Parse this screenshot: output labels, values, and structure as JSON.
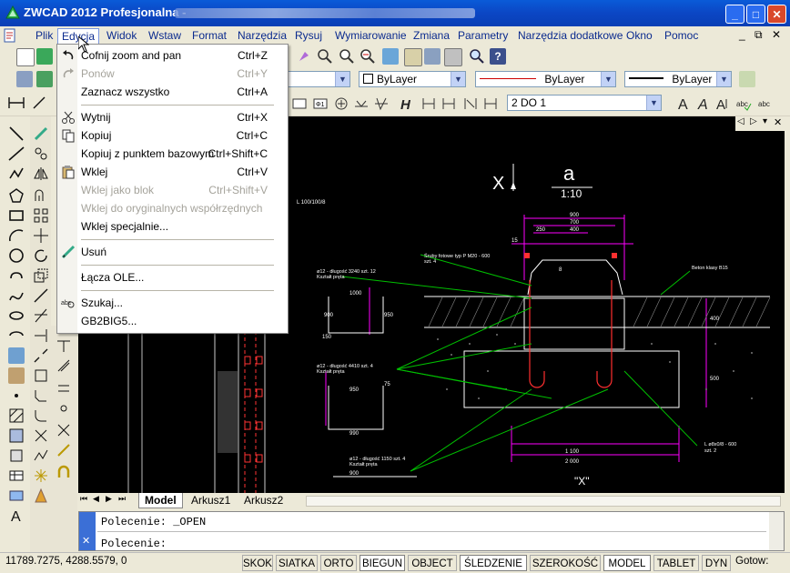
{
  "window": {
    "title": "ZWCAD 2012 Profesjonalna -",
    "minimize_glyph": "_",
    "maximize_glyph": "□",
    "close_glyph": "✕"
  },
  "menubar": {
    "items": [
      "Plik",
      "Edycja",
      "Widok",
      "Wstaw",
      "Format",
      "Narzędzia",
      "Rysuj",
      "Wymiarowanie",
      "Zmiana",
      "Parametry",
      "Narzędzia dodatkowe",
      "Okno",
      "Pomoc"
    ],
    "active": "Edycja",
    "doc_controls": [
      "_",
      "⧉",
      "✕"
    ]
  },
  "properties": {
    "color": "ByLayer",
    "linetype": "ByLayer",
    "lineweight": "ByLayer",
    "dimstyle": "2 DO 1"
  },
  "edit_menu": {
    "items": [
      {
        "label": "Cofnij  zoom and pan",
        "shortcut": "Ctrl+Z",
        "disabled": false,
        "icon": "undo-icon"
      },
      {
        "label": "Ponów",
        "shortcut": "Ctrl+Y",
        "disabled": true,
        "icon": "redo-icon"
      },
      {
        "label": "Zaznacz wszystko",
        "shortcut": "Ctrl+A",
        "disabled": false,
        "icon": ""
      },
      {
        "label": "Wytnij",
        "shortcut": "Ctrl+X",
        "disabled": false,
        "icon": "scissors-icon"
      },
      {
        "label": "Kopiuj",
        "shortcut": "Ctrl+C",
        "disabled": false,
        "icon": "copy-icon"
      },
      {
        "label": "Kopiuj z punktem bazowym",
        "shortcut": "Ctrl+Shift+C",
        "disabled": false,
        "icon": ""
      },
      {
        "label": "Wklej",
        "shortcut": "Ctrl+V",
        "disabled": false,
        "icon": "paste-icon"
      },
      {
        "label": "Wklej jako blok",
        "shortcut": "Ctrl+Shift+V",
        "disabled": true,
        "icon": ""
      },
      {
        "label": "Wklej do oryginalnych współrzędnych",
        "shortcut": "",
        "disabled": true,
        "icon": ""
      },
      {
        "label": "Wklej specjalnie...",
        "shortcut": "",
        "disabled": false,
        "icon": ""
      },
      {
        "label": "Usuń",
        "shortcut": "",
        "disabled": false,
        "icon": "erase-icon"
      },
      {
        "label": "Łącza OLE...",
        "shortcut": "",
        "disabled": false,
        "icon": ""
      },
      {
        "label": "Szukaj...",
        "shortcut": "",
        "disabled": false,
        "icon": "find-icon"
      },
      {
        "label": "GB2BIG5...",
        "shortcut": "",
        "disabled": false,
        "icon": ""
      }
    ]
  },
  "drawing": {
    "section_label": "a",
    "section_cut": "X",
    "scale": "1:10",
    "dims_top": [
      "900",
      "700",
      "400",
      "250",
      "15",
      "8"
    ],
    "dims_bottom": [
      "1 100",
      "2 000"
    ],
    "dims_side": [
      "400",
      "500",
      "400",
      "100"
    ],
    "notes": [
      "Śruby fotowe typ P M20 - 600",
      "szt. 4",
      "ø12 - długość 3240   szt. 12",
      "Kształt pręta",
      "ø12 - długość 4410   szt. 4",
      "Kształt pręta",
      "ø12 - długość 1150   szt. 4",
      "Kształt pręta",
      "Beton klasy B15",
      "L ø8x0/8 - 600",
      "szt. 2",
      "L 100/100/8"
    ],
    "bar_dims": [
      "1000",
      "900",
      "150",
      "950",
      "1000",
      "950",
      "75",
      "990",
      "75",
      "990",
      "75",
      "900",
      "75"
    ],
    "section_bottom": "\"X\""
  },
  "layout_tabs": [
    "Model",
    "Arkusz1",
    "Arkusz2"
  ],
  "command": {
    "history": "Polecenie: _OPEN",
    "prompt": "Polecenie:"
  },
  "status": {
    "coords": "11789.7275,  4288.5579,  0",
    "toggles": [
      "SKOK",
      "SIATKA",
      "ORTO",
      "BIEGUN",
      "OBJECT",
      "ŚLEDZENIE",
      "SZEROKOŚĆ",
      "MODEL",
      "TABLET",
      "DYN"
    ],
    "on": [
      "BIEGUN",
      "ŚLEDZENIE",
      "MODEL"
    ],
    "ready": "Gotow:"
  },
  "colors": {
    "titlebar": "#0b46c4",
    "menu_text": "#0a2a8e",
    "drawing_bg": "#000000",
    "magenta_dims": "#ff00ff",
    "green_leaders": "#00c000",
    "red_bars": "#ff3030"
  }
}
